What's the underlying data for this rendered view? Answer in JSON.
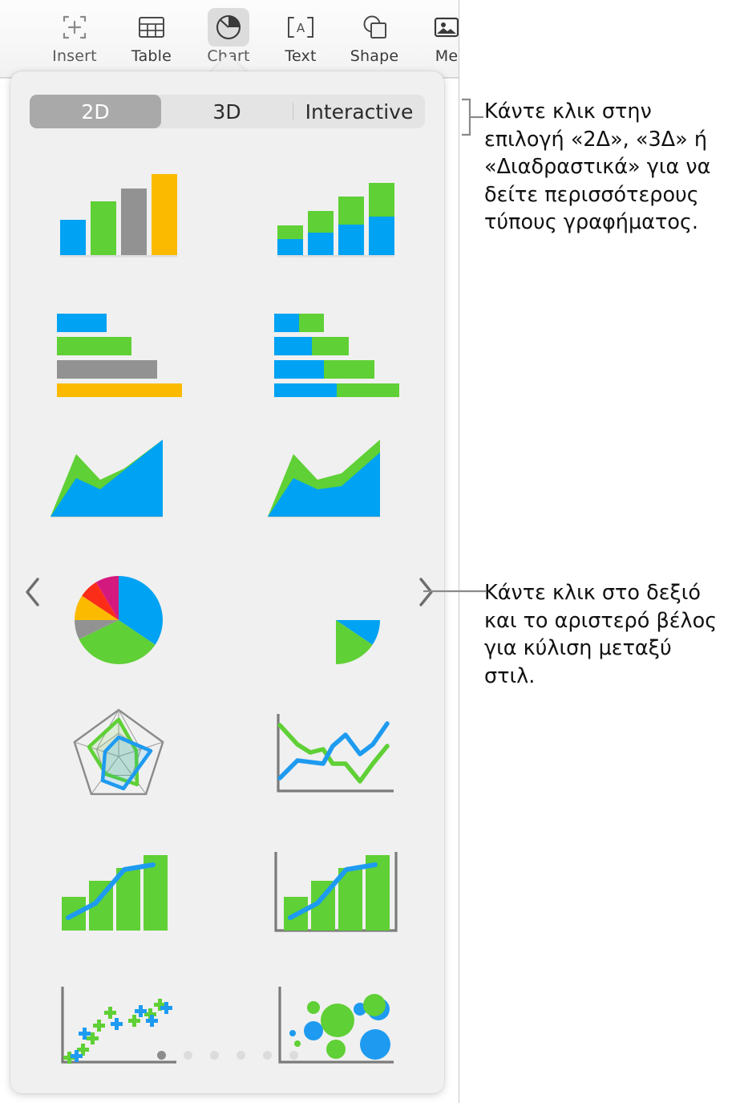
{
  "toolbar": {
    "items": [
      {
        "name": "insert",
        "label": "Insert",
        "icon": "insert-icon",
        "active": false
      },
      {
        "name": "table",
        "label": "Table",
        "icon": "table-icon",
        "active": false
      },
      {
        "name": "chart",
        "label": "Chart",
        "icon": "chart-pie-icon",
        "active": true
      },
      {
        "name": "text",
        "label": "Text",
        "icon": "text-box-icon",
        "active": false
      },
      {
        "name": "shape",
        "label": "Shape",
        "icon": "shape-icon",
        "active": false
      },
      {
        "name": "media",
        "label": "Me",
        "icon": "media-icon",
        "active": false
      }
    ]
  },
  "popover": {
    "tabs": [
      {
        "name": "2d",
        "label": "2D",
        "selected": true
      },
      {
        "name": "3d",
        "label": "3D",
        "selected": false
      },
      {
        "name": "interactive",
        "label": "Interactive",
        "selected": false
      }
    ],
    "charts": [
      {
        "name": "column-chart",
        "type": "column"
      },
      {
        "name": "stacked-column-chart",
        "type": "stacked-column"
      },
      {
        "name": "bar-chart",
        "type": "bar"
      },
      {
        "name": "stacked-bar-chart",
        "type": "stacked-bar"
      },
      {
        "name": "area-chart",
        "type": "area"
      },
      {
        "name": "stacked-area-chart",
        "type": "stacked-area"
      },
      {
        "name": "pie-chart",
        "type": "pie"
      },
      {
        "name": "donut-chart",
        "type": "donut"
      },
      {
        "name": "radar-chart",
        "type": "radar"
      },
      {
        "name": "line-chart",
        "type": "line"
      },
      {
        "name": "combo-chart",
        "type": "combo"
      },
      {
        "name": "combo-axis-chart",
        "type": "combo-axis"
      },
      {
        "name": "scatter-chart",
        "type": "scatter"
      },
      {
        "name": "bubble-chart",
        "type": "bubble"
      }
    ],
    "page_dots": {
      "count": 6,
      "active_index": 0
    },
    "prev_arrow_label": "‹",
    "next_arrow_label": "›"
  },
  "annotations": {
    "callout_tabs": "Κάντε κλικ στην επιλογή «2Δ», «3Δ» ή «Διαδραστικά» για να δείτε περισσότερους τύπους γραφήματος.",
    "callout_arrows": "Κάντε κλικ στο δεξιό και το αριστερό βέλος για κύλιση μεταξύ στιλ."
  },
  "colors": {
    "blue": "#00a2f3",
    "green": "#5fd035",
    "gray": "#929292",
    "amber": "#fbba00",
    "red": "#fb2d18",
    "magenta": "#d4197e",
    "popover_bg": "#f0f0f0",
    "segment_track": "#e4e4e4",
    "segment_selected": "#a9a9a9",
    "dot_active": "#8c8c8c",
    "dot_inactive": "#dcdcdc",
    "axis": "#7b7b7b"
  }
}
